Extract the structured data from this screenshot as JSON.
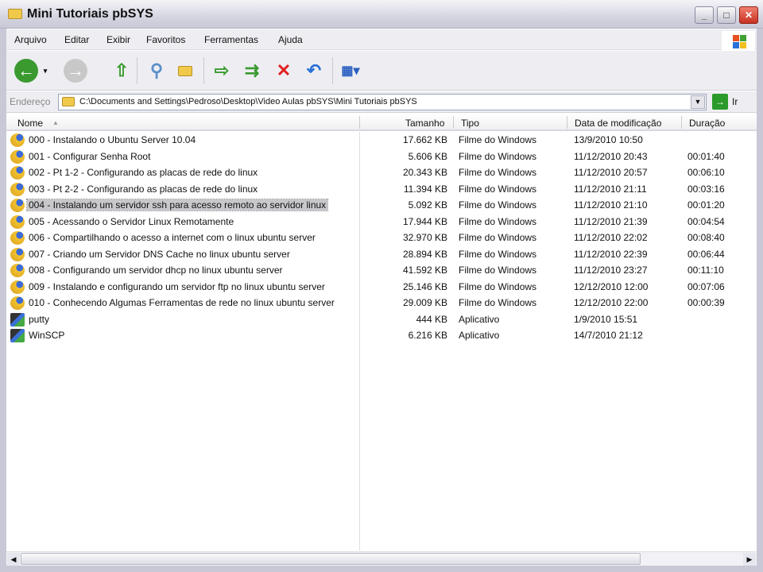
{
  "window": {
    "title": "Mini Tutoriais pbSYS",
    "minimize": "_",
    "maximize": "□",
    "close": "✕"
  },
  "menu": [
    "Arquivo",
    "Editar",
    "Exibir",
    "Favoritos",
    "Ferramentas",
    "Ajuda"
  ],
  "address": {
    "label": "Endereço",
    "path": "C:\\Documents and Settings\\Pedroso\\Desktop\\Video Aulas pbSYS\\Mini Tutoriais pbSYS",
    "go": "Ir"
  },
  "columns": {
    "name": "Nome",
    "size": "Tamanho",
    "type": "Tipo",
    "date": "Data de modificação",
    "duration": "Duração"
  },
  "files": [
    {
      "name": "000 - Instalando o Ubuntu Server 10.04",
      "size": "17.662 KB",
      "type": "Filme do Windows",
      "date": "13/9/2010 10:50",
      "duration": ""
    },
    {
      "name": "001 - Configurar Senha Root",
      "size": "5.606 KB",
      "type": "Filme do Windows",
      "date": "11/12/2010 20:43",
      "duration": "00:01:40"
    },
    {
      "name": "002 - Pt 1-2 - Configurando as placas de rede do linux",
      "size": "20.343 KB",
      "type": "Filme do Windows",
      "date": "11/12/2010 20:57",
      "duration": "00:06:10"
    },
    {
      "name": "003 - Pt 2-2 - Configurando as placas de rede do linux",
      "size": "11.394 KB",
      "type": "Filme do Windows",
      "date": "11/12/2010 21:11",
      "duration": "00:03:16"
    },
    {
      "name": "004 - Instalando um servidor ssh para acesso remoto ao servidor linux",
      "size": "5.092 KB",
      "type": "Filme do Windows",
      "date": "11/12/2010 21:10",
      "duration": "00:01:20"
    },
    {
      "name": "005 - Acessando o Servidor Linux Remotamente",
      "size": "17.944 KB",
      "type": "Filme do Windows",
      "date": "11/12/2010 21:39",
      "duration": "00:04:54"
    },
    {
      "name": "006 - Compartilhando o acesso a internet com o linux ubuntu server",
      "size": "32.970 KB",
      "type": "Filme do Windows",
      "date": "11/12/2010 22:02",
      "duration": "00:08:40"
    },
    {
      "name": "007 - Criando um Servidor DNS Cache no linux ubuntu server",
      "size": "28.894 KB",
      "type": "Filme do Windows",
      "date": "11/12/2010 22:39",
      "duration": "00:06:44"
    },
    {
      "name": "008 - Configurando um servidor dhcp no linux ubuntu server",
      "size": "41.592 KB",
      "type": "Filme do Windows",
      "date": "11/12/2010 23:27",
      "duration": "00:11:10"
    },
    {
      "name": "009 - Instalando e configurando um servidor ftp no linux ubuntu server",
      "size": "25.146 KB",
      "type": "Filme do Windows",
      "date": "12/12/2010 12:00",
      "duration": "00:07:06"
    },
    {
      "name": "010 - Conhecendo Algumas Ferramentas de rede no linux ubuntu server",
      "size": "29.009 KB",
      "type": "Filme do Windows",
      "date": "12/12/2010 22:00",
      "duration": "00:00:39"
    },
    {
      "name": "putty",
      "size": "444 KB",
      "type": "Aplicativo",
      "date": "1/9/2010 15:51",
      "duration": ""
    },
    {
      "name": "WinSCP",
      "size": "6.216 KB",
      "type": "Aplicativo",
      "date": "14/7/2010 21:12",
      "duration": ""
    }
  ]
}
